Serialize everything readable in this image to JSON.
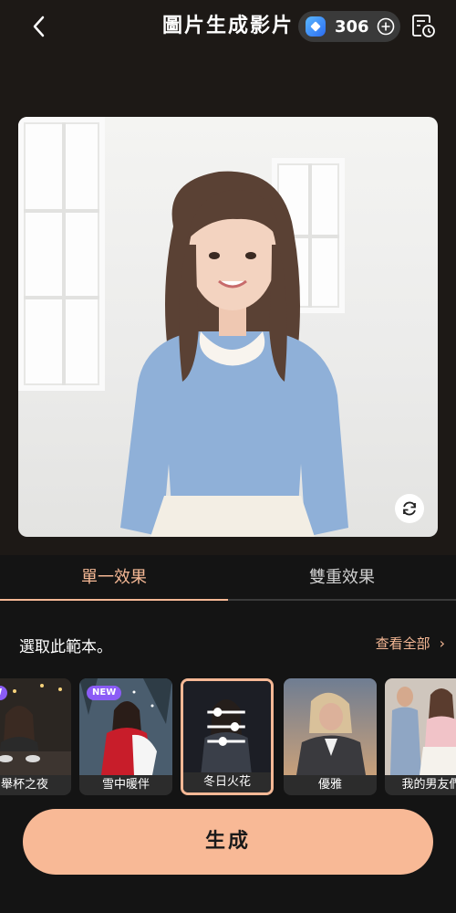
{
  "header": {
    "title": "圖片生成影片",
    "credits": "306"
  },
  "tabs": [
    {
      "label": "單一效果",
      "active": true
    },
    {
      "label": "雙重效果",
      "active": false
    }
  ],
  "section": {
    "label": "選取此範本。",
    "see_all": "查看全部"
  },
  "templates": [
    {
      "label": "舉杯之夜",
      "badge": "NEW",
      "selected": false
    },
    {
      "label": "雪中暖伴",
      "badge": "NEW",
      "selected": false
    },
    {
      "label": "冬日火花",
      "badge": "",
      "selected": true
    },
    {
      "label": "優雅",
      "badge": "",
      "selected": false
    },
    {
      "label": "我的男友們",
      "badge": "",
      "selected": false
    }
  ],
  "generate_label": "生成",
  "colors": {
    "accent": "#f5b895",
    "button": "#f8b996",
    "background": "#141414"
  }
}
